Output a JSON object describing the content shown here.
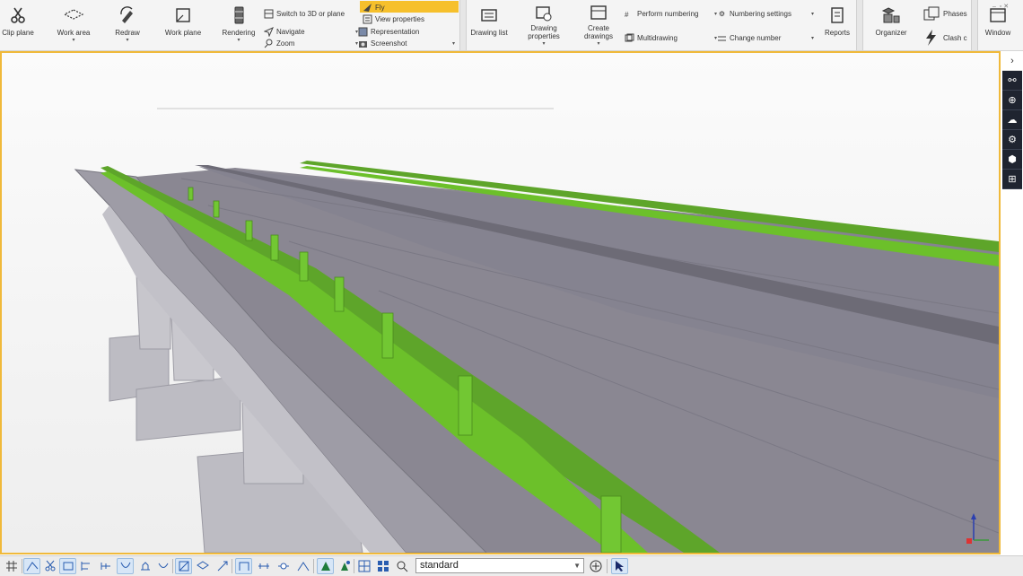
{
  "ribbon": {
    "clip_plane": "Clip plane",
    "work_area": "Work area",
    "redraw": "Redraw",
    "work_plane": "Work plane",
    "rendering": "Rendering",
    "switch_3d": "Switch to 3D or plane",
    "navigate": "Navigate",
    "zoom": "Zoom",
    "fly": "Fly",
    "view_properties": "View properties",
    "representation": "Representation",
    "screenshot": "Screenshot",
    "drawing_list": "Drawing list",
    "drawing_properties": "Drawing properties",
    "create_drawings": "Create drawings",
    "perform_numbering": "Perform numbering",
    "multidrawing": "Multidrawing",
    "numbering_settings": "Numbering settings",
    "change_number": "Change number",
    "reports": "Reports",
    "organizer": "Organizer",
    "phases": "Phases",
    "clash": "Clash c",
    "window": "Window"
  },
  "bottombar": {
    "filter_value": "standard"
  },
  "colors": {
    "accent": "#f0b93a",
    "railing": "#6cc02a",
    "concrete": "#8a8792",
    "sidepanel": "#1f2430"
  }
}
